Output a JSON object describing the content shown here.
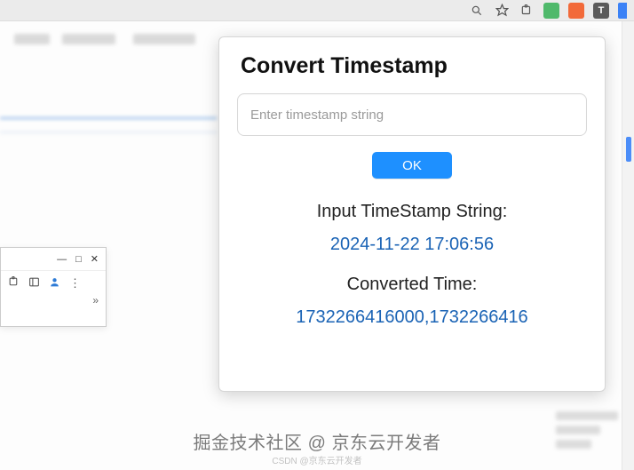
{
  "chrome": {
    "zoom_icon": "zoom",
    "star_icon": "star",
    "ext_t_label": "T"
  },
  "popup": {
    "title": "Convert Timestamp",
    "input_placeholder": "Enter timestamp string",
    "input_value": "",
    "ok_label": "OK",
    "input_label": "Input TimeStamp String:",
    "input_result": "2024-11-22 17:06:56",
    "converted_label": "Converted Time:",
    "converted_result": "1732266416000,1732266416"
  },
  "mini_window": {
    "minimize": "—",
    "maximize": "□",
    "close": "✕",
    "more": "»"
  },
  "watermark": {
    "main": "掘金技术社区 @ 京东云开发者",
    "sub": "CSDN @京东云开发者"
  }
}
